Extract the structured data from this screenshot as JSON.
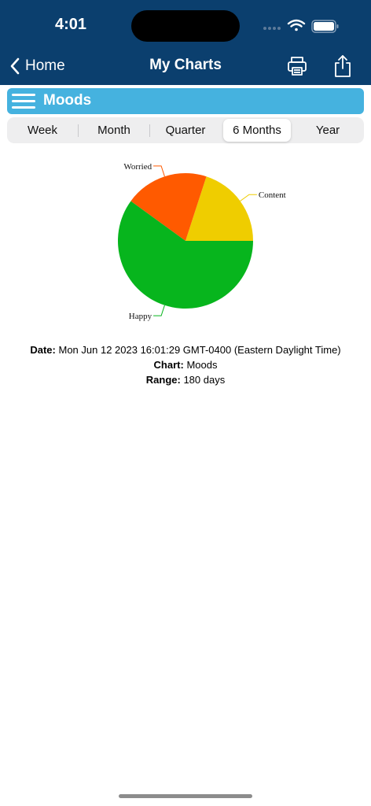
{
  "status_bar": {
    "time": "4:01"
  },
  "nav": {
    "back_label": "Home",
    "title": "My Charts",
    "print_icon": "printer-icon",
    "share_icon": "share-icon"
  },
  "header": {
    "title": "Moods",
    "menu_icon": "hamburger-menu-icon"
  },
  "segments": {
    "items": [
      "Week",
      "Month",
      "Quarter",
      "6 Months",
      "Year"
    ],
    "selected": "6 Months"
  },
  "chart_data": {
    "type": "pie",
    "slices": [
      {
        "label": "Content",
        "value": 20,
        "color": "#efcd00"
      },
      {
        "label": "Worried",
        "value": 20,
        "color": "#ff5a00"
      },
      {
        "label": "Happy",
        "value": 60,
        "color": "#07b51d"
      }
    ]
  },
  "info": {
    "date_label": "Date:",
    "date_value": "Mon Jun 12 2023 16:01:29 GMT-0400 (Eastern Daylight Time)",
    "chart_label": "Chart:",
    "chart_value": "Moods",
    "range_label": "Range:",
    "range_value": "180 days"
  }
}
